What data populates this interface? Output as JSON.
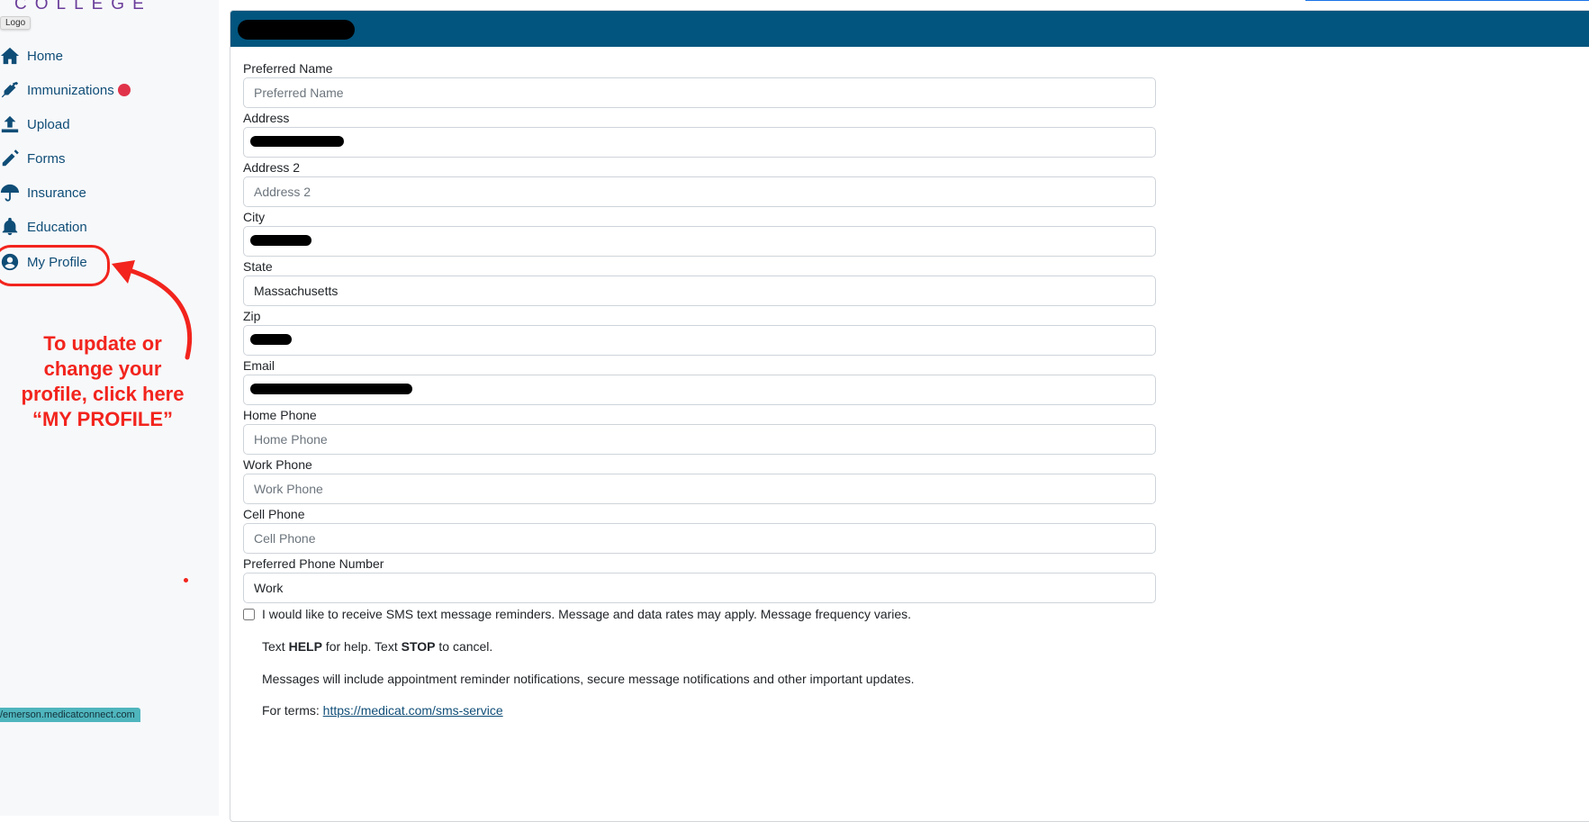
{
  "sidebar": {
    "brand_text": "COLLEGE",
    "logo_tooltip": "Logo",
    "items": [
      {
        "label": "Home",
        "icon": "home-icon"
      },
      {
        "label": "Immunizations",
        "icon": "syringe-icon",
        "alert": true
      },
      {
        "label": "Upload",
        "icon": "upload-icon"
      },
      {
        "label": "Forms",
        "icon": "pencil-icon"
      },
      {
        "label": "Insurance",
        "icon": "umbrella-icon"
      },
      {
        "label": "Education",
        "icon": "bell-icon"
      },
      {
        "label": "My Profile",
        "icon": "user-circle-icon"
      }
    ],
    "annotation": {
      "text_line1": "To update or",
      "text_line2": "change your",
      "text_line3": "profile, click here",
      "text_line4": "“MY PROFILE”",
      "color": "#f2241d"
    },
    "status_url": "/emerson.medicatconnect.com"
  },
  "card": {
    "header_color": "#02557e",
    "title_redacted": true
  },
  "form": {
    "fields": [
      {
        "label": "Preferred Name",
        "value": "",
        "placeholder": "Preferred Name"
      },
      {
        "label": "Address",
        "value": "",
        "placeholder": "",
        "redacted": true
      },
      {
        "label": "Address 2",
        "value": "",
        "placeholder": "Address 2"
      },
      {
        "label": "City",
        "value": "",
        "placeholder": "",
        "redacted": true
      },
      {
        "label": "State",
        "value": "Massachusetts",
        "placeholder": ""
      },
      {
        "label": "Zip",
        "value": "",
        "placeholder": "",
        "redacted": true
      },
      {
        "label": "Email",
        "value": "",
        "placeholder": "",
        "redacted": true
      },
      {
        "label": "Home Phone",
        "value": "",
        "placeholder": "Home Phone"
      },
      {
        "label": "Work Phone",
        "value": "",
        "placeholder": "Work Phone"
      },
      {
        "label": "Cell Phone",
        "value": "",
        "placeholder": "Cell Phone"
      },
      {
        "label": "Preferred Phone Number",
        "value": "Work",
        "placeholder": ""
      }
    ],
    "sms": {
      "checked": false,
      "checkbox_label": "I would like to receive SMS text message reminders. Message and data rates may apply. Message frequency varies.",
      "help_prefix": "Text ",
      "help_keyword": "HELP",
      "help_middle": " for help. Text ",
      "stop_keyword": "STOP",
      "help_suffix": " to cancel.",
      "messages_info": "Messages will include appointment reminder notifications, secure message notifications and other important updates.",
      "terms_prefix": "For terms: ",
      "terms_link": "https://medicat.com/sms-service"
    }
  }
}
